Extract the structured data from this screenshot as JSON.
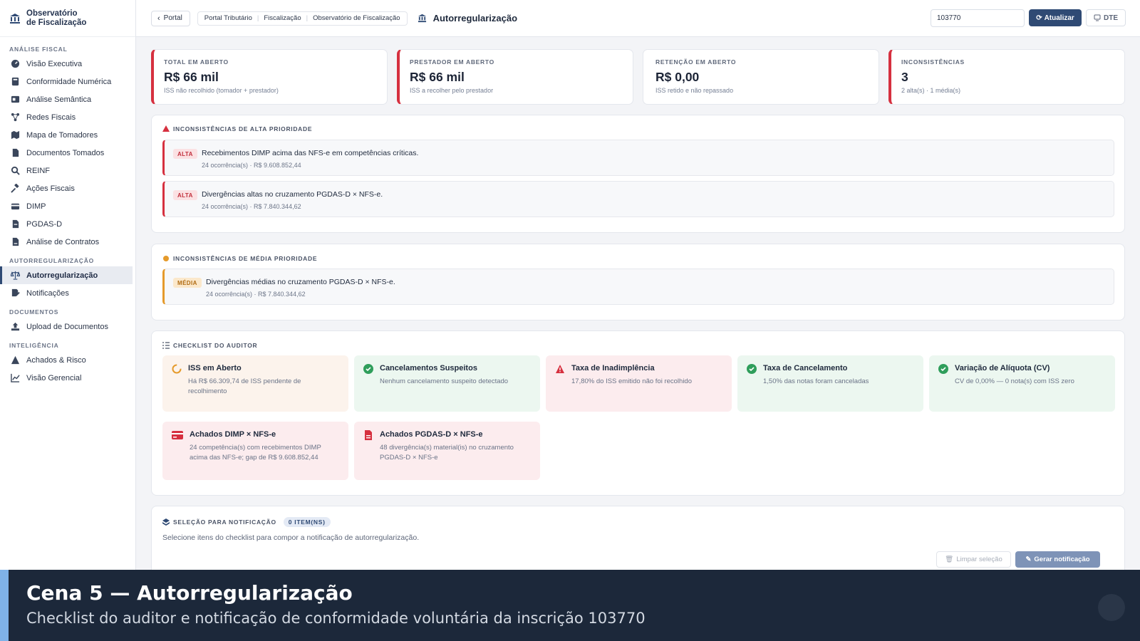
{
  "brand": {
    "title_line1": "Observatório",
    "title_line2": "de Fiscalização"
  },
  "sidebar": {
    "sections": [
      {
        "label": "Análise Fiscal"
      },
      {
        "label": "Autorregularização"
      },
      {
        "label": "Documentos"
      },
      {
        "label": "Inteligência"
      }
    ],
    "items": [
      {
        "label": "Visão Executiva",
        "icon": "gauge-icon"
      },
      {
        "label": "Conformidade Numérica",
        "icon": "calculator-icon"
      },
      {
        "label": "Análise Semântica",
        "icon": "text-analysis-icon"
      },
      {
        "label": "Redes Fiscais",
        "icon": "network-icon"
      },
      {
        "label": "Mapa de Tomadores",
        "icon": "map-icon"
      },
      {
        "label": "Documentos Tomados",
        "icon": "document-icon"
      },
      {
        "label": "REINF",
        "icon": "search-icon"
      },
      {
        "label": "Ações Fiscais",
        "icon": "gavel-icon"
      },
      {
        "label": "DIMP",
        "icon": "card-icon"
      },
      {
        "label": "PGDAS-D",
        "icon": "file-icon"
      },
      {
        "label": "Análise de Contratos",
        "icon": "contract-icon"
      },
      {
        "label": "Autorregularização",
        "icon": "scale-icon",
        "active": true
      },
      {
        "label": "Notificações",
        "icon": "notification-icon"
      },
      {
        "label": "Upload de Documentos",
        "icon": "upload-icon"
      },
      {
        "label": "Achados & Risco",
        "icon": "warning-icon"
      },
      {
        "label": "Visão Gerencial",
        "icon": "chart-line-icon"
      }
    ]
  },
  "topbar": {
    "back_label": "Portal",
    "breadcrumbs": [
      "Portal Tributário",
      "Fiscalização",
      "Observatório de Fiscalização"
    ],
    "title": "Autorregularização",
    "search_value": "103770",
    "refresh_label": "Atualizar",
    "dte_label": "DTE"
  },
  "kpis": [
    {
      "label": "Total em aberto",
      "value": "R$ 66 mil",
      "sub": "ISS não recolhido (tomador + prestador)",
      "accent": "#d6303f"
    },
    {
      "label": "Prestador em aberto",
      "value": "R$ 66 mil",
      "sub": "ISS a recolher pelo prestador",
      "accent": "#d6303f"
    },
    {
      "label": "Retenção em aberto",
      "value": "R$ 0,00",
      "sub": "ISS retido e não repassado",
      "accent": null
    },
    {
      "label": "Inconsistências",
      "value": "3",
      "sub": "2 alta(s) · 1 média(s)",
      "accent": "#d6303f"
    }
  ],
  "high_priority": {
    "title": "Inconsistências de alta prioridade",
    "items": [
      {
        "badge": "ALTA",
        "title": "Recebimentos DIMP acima das NFS-e em competências críticas.",
        "sub": "24 ocorrência(s) · R$ 9.608.852,44"
      },
      {
        "badge": "ALTA",
        "title": "Divergências altas no cruzamento PGDAS-D × NFS-e.",
        "sub": "24 ocorrência(s) · R$ 7.840.344,62"
      }
    ]
  },
  "medium_priority": {
    "title": "Inconsistências de média prioridade",
    "items": [
      {
        "badge": "MÉDIA",
        "title": "Divergências médias no cruzamento PGDAS-D × NFS-e.",
        "sub": "24 ocorrência(s) · R$ 7.840.344,62"
      }
    ]
  },
  "checklist": {
    "title": "Checklist do auditor",
    "items": [
      {
        "title": "ISS em Aberto",
        "desc": "Há R$ 66.309,74 de ISS pendente de recolhimento",
        "status": "warn",
        "icon": "spinner-icon"
      },
      {
        "title": "Cancelamentos Suspeitos",
        "desc": "Nenhum cancelamento suspeito detectado",
        "status": "ok",
        "icon": "check-circle-icon"
      },
      {
        "title": "Taxa de Inadimplência",
        "desc": "17,80% do ISS emitido não foi recolhido",
        "status": "bad",
        "icon": "warning-icon"
      },
      {
        "title": "Taxa de Cancelamento",
        "desc": "1,50% das notas foram canceladas",
        "status": "ok",
        "icon": "check-circle-icon"
      },
      {
        "title": "Variação de Alíquota (CV)",
        "desc": "CV de 0,00% — 0 nota(s) com ISS zero",
        "status": "ok",
        "icon": "check-circle-icon"
      },
      {
        "title": "Achados DIMP × NFS-e",
        "desc": "24 competência(s) com recebimentos DIMP acima das NFS-e; gap de R$ 9.608.852,44",
        "status": "bad",
        "icon": "card-icon"
      },
      {
        "title": "Achados PGDAS-D × NFS-e",
        "desc": "48 divergência(s) material(is) no cruzamento PGDAS-D × NFS-e",
        "status": "bad",
        "icon": "file-icon"
      }
    ]
  },
  "selection": {
    "title": "Seleção para notificação",
    "count": "0 ITEM(NS)",
    "text": "Selecione itens do checklist para compor a notificação de autorregularização.",
    "clear_label": "Limpar seleção",
    "generate_label": "Gerar notificação"
  },
  "caption": {
    "title": "Cena 5 — Autorregularização",
    "subtitle": "Checklist do auditor e notificação de conformidade voluntária da inscrição 103770"
  },
  "colors": {
    "primary": "#2f4a74",
    "danger": "#d6303f",
    "warning": "#e59a2b",
    "success": "#2f9e5b"
  }
}
